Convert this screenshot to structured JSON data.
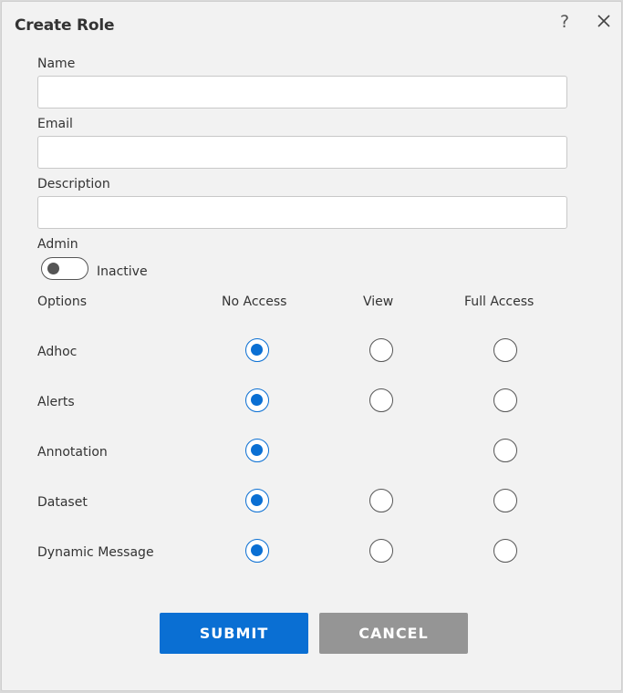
{
  "dialog": {
    "title": "Create Role",
    "help_glyph": "?",
    "close_icon": "close-icon"
  },
  "form": {
    "name_label": "Name",
    "name_value": "",
    "email_label": "Email",
    "email_value": "",
    "description_label": "Description",
    "description_value": "",
    "admin_label": "Admin",
    "admin_state": "Inactive",
    "admin_enabled": false
  },
  "permissions": {
    "headers": [
      "Options",
      "No Access",
      "View",
      "Full Access"
    ],
    "rows": [
      {
        "label": "Adhoc",
        "selected": "No Access"
      },
      {
        "label": "Alerts",
        "selected": "No Access"
      },
      {
        "label": "Annotation",
        "selected": "No Access"
      },
      {
        "label": "Dataset",
        "selected": "No Access"
      },
      {
        "label": "Dynamic Message",
        "selected": "No Access"
      }
    ]
  },
  "buttons": {
    "submit": "SUBMIT",
    "cancel": "CANCEL"
  },
  "colors": {
    "accent": "#0a6fd3",
    "cancel": "#959595",
    "background": "#f2f2f2"
  }
}
